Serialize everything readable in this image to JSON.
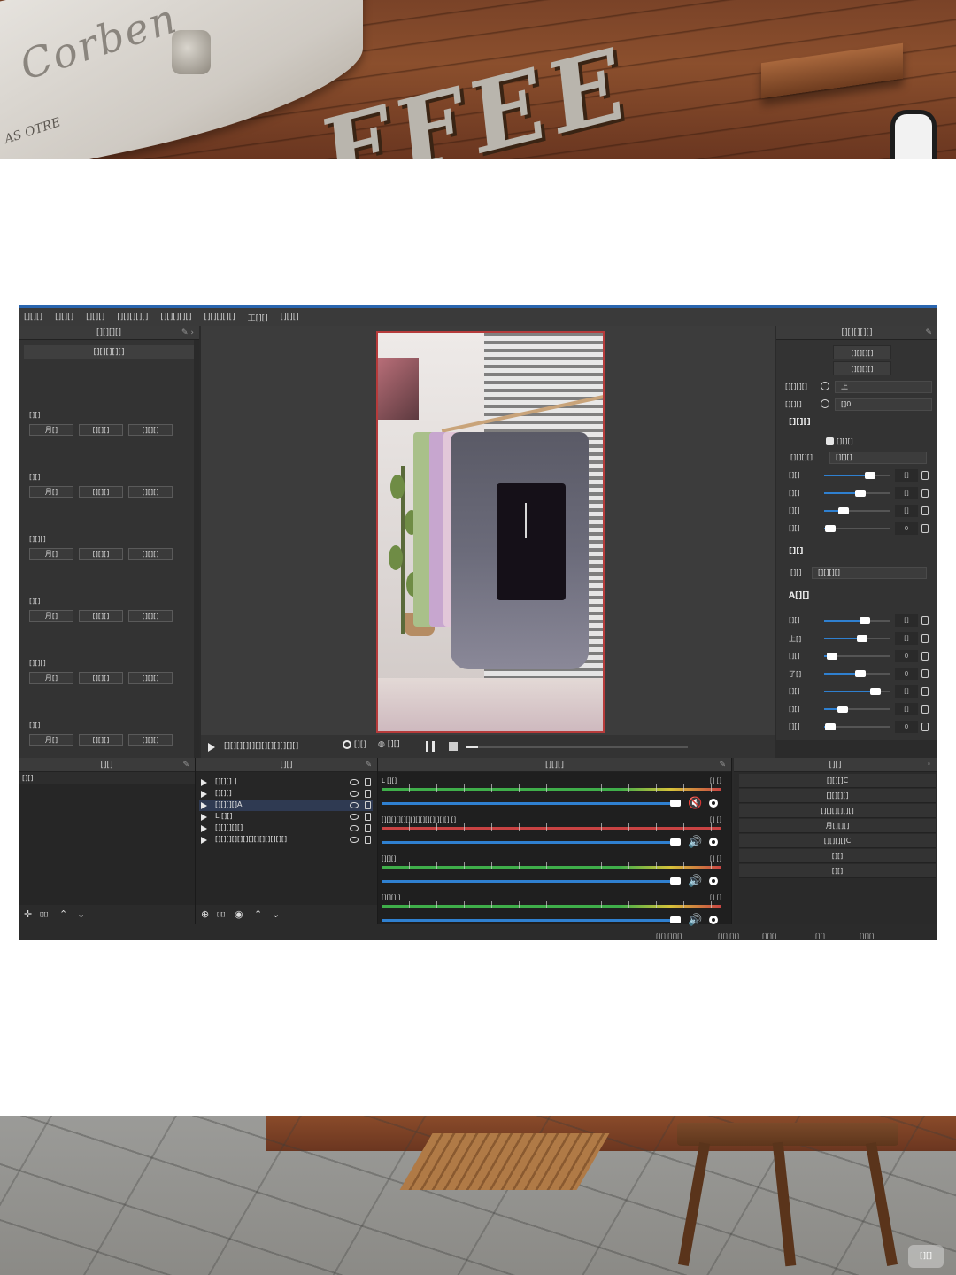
{
  "editor": {
    "menu": [
      "[][][]",
      "[][][]",
      "[][][]",
      "[][][][][]",
      "[][][][][]",
      "[][][][][]",
      "工[][]",
      "[][][]"
    ],
    "left_panel": {
      "title": "[][][][]",
      "section_bar": "[][][][][]",
      "groups": [
        {
          "label": "[][]",
          "buttons": [
            "月[]",
            "[][][]",
            "[][][]"
          ]
        },
        {
          "label": "[][]",
          "buttons": [
            "月[]",
            "[][][]",
            "[][][]"
          ]
        },
        {
          "label": "[][][]",
          "buttons": [
            "月[]",
            "[][][]",
            "[][][]"
          ]
        },
        {
          "label": "[][]",
          "buttons": [
            "月[]",
            "[][][]",
            "[][][]"
          ]
        },
        {
          "label": "[][][]",
          "buttons": [
            "月[]",
            "[][][]",
            "[][][]"
          ]
        },
        {
          "label": "[][]",
          "buttons": [
            "月[]",
            "[][][]",
            "[][][]"
          ]
        }
      ]
    },
    "transport": {
      "text_after_play": "[][][][][][][][][][][][]",
      "record_label": "[][]",
      "snapshot_label": "[][]",
      "progress": 0.05
    },
    "right_panel": {
      "title": "[][][][][]",
      "btn1": "[][][][]",
      "btn2": "[][][][]",
      "field1_label": "[][][][]",
      "field1_value": "上",
      "field2_label": "[][][]",
      "field2_value": "[]0",
      "section1": "[][][]",
      "checkbox_label": "[][][]",
      "preset_label": "[][][][]",
      "preset_value": "[][][]",
      "sliders1": [
        {
          "label": "[][]",
          "value": "[]",
          "level": 0.7
        },
        {
          "label": "[][]",
          "value": "[]",
          "level": 0.55
        },
        {
          "label": "[][]",
          "value": "[]",
          "level": 0.3
        },
        {
          "label": "[][]",
          "value": "0",
          "level": 0.1
        }
      ],
      "section2": "[][]",
      "mode_label": "[][]",
      "mode_value": "[][][][]",
      "section3": "A[][]",
      "sliders2": [
        {
          "label": "[][]",
          "value": "[]",
          "level": 0.62
        },
        {
          "label": "上[]",
          "value": "[]",
          "level": 0.58
        },
        {
          "label": "[][]",
          "value": "0",
          "level": 0.12
        },
        {
          "label": "了[]",
          "value": "0",
          "level": 0.55
        },
        {
          "label": "[][]",
          "value": "[]",
          "level": 0.78
        },
        {
          "label": "[][]",
          "value": "[]",
          "level": 0.28
        },
        {
          "label": "[][]",
          "value": "0",
          "level": 0.1
        }
      ]
    },
    "docks": {
      "scenes_title": "[][]",
      "scene_item": "[][]",
      "sources_title": "[][]",
      "sources": [
        {
          "name": "[][][] ]",
          "selected": false
        },
        {
          "name": "[][][]",
          "selected": false
        },
        {
          "name": "[][][][]A",
          "selected": true
        },
        {
          "name": "L [][]",
          "selected": false
        },
        {
          "name": "[][][][][]",
          "selected": false
        },
        {
          "name": "[][][][][][][][][][][][][]",
          "selected": false
        }
      ],
      "mixer_title": "[][][]",
      "tracks": [
        {
          "name": "L [][]",
          "db": "[] []",
          "muted": true
        },
        {
          "name": "[][][][][][][][][][][][][][] []",
          "db": "[] []",
          "muted": false
        },
        {
          "name": "[][][]",
          "db": "[] []",
          "muted": false
        },
        {
          "name": "[][][] ]",
          "db": "[] []",
          "muted": false
        }
      ],
      "transitions_title": "[][]",
      "transitions": [
        "[][][]C",
        "[][][][]",
        "[][][][][][]",
        "月[][][]",
        "[][][][]C",
        "[][]",
        "[][]"
      ],
      "footer_small": "[][]"
    },
    "statusbar": [
      "[][] [][][]",
      "[][] [][]",
      "[][][]",
      "[][]",
      "[][][]"
    ]
  },
  "background": {
    "awning_script": "Corben",
    "awning_small": "AS OTRE",
    "sign_text": "FFEE",
    "watermark": "[][]"
  }
}
